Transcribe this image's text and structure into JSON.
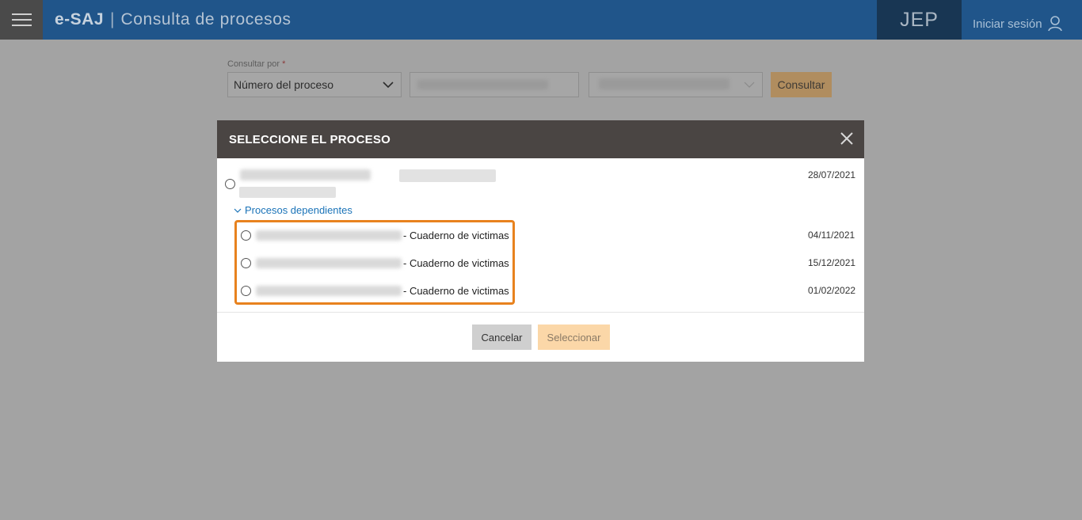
{
  "header": {
    "logo": "e-SAJ",
    "separator": "|",
    "title": "Consulta de procesos",
    "org": "JEP",
    "login_label": "Iniciar sesión"
  },
  "search": {
    "label": "Consultar por",
    "required_mark": "*",
    "type_value": "Número del proceso",
    "submit_label": "Consultar"
  },
  "modal": {
    "title": "SELECCIONE EL PROCESO",
    "main_process": {
      "date": "28/07/2021"
    },
    "dependents_toggle": "Procesos dependientes",
    "dependents": [
      {
        "label": "- Cuaderno de victimas",
        "date": "04/11/2021"
      },
      {
        "label": "- Cuaderno de victimas",
        "date": "15/12/2021"
      },
      {
        "label": "- Cuaderno de victimas",
        "date": "01/02/2022"
      }
    ],
    "cancel_label": "Cancelar",
    "select_label": "Seleccionar"
  },
  "colors": {
    "header_bg": "#20558a",
    "modal_header_bg": "#4a4543",
    "highlight": "#e8821e",
    "link": "#1a73b8",
    "select_button": "#fbd7a8"
  },
  "icons": [
    "menu-icon",
    "user-icon",
    "chevron-down-icon",
    "close-icon",
    "chevron-down-small-icon"
  ]
}
